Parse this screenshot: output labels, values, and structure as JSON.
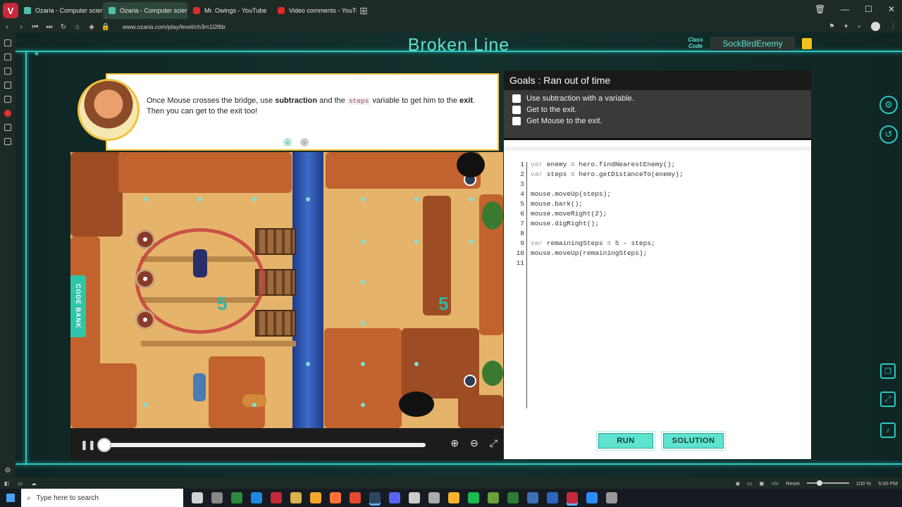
{
  "browser": {
    "tabs": [
      {
        "label": "Ozaria - Computer science",
        "favicon": "ozaria-icon",
        "active": false
      },
      {
        "label": "Ozaria - Computer science",
        "favicon": "ozaria-icon",
        "active": true
      },
      {
        "label": "Mr. Owings - YouTube",
        "favicon": "youtube-icon",
        "active": false
      },
      {
        "label": "Video comments - YouTube",
        "favicon": "youtube-icon",
        "active": false
      }
    ],
    "url": "www.ozaria.com/play/level/ch3m1l2l6b"
  },
  "game": {
    "title": "Broken Line",
    "class_code_label": "Class Code",
    "class_code_value": "SockBirdEnemy",
    "dialogue": {
      "text_parts": [
        "Once Mouse crosses the bridge, use ",
        "subtraction",
        " and the ",
        "steps",
        " variable to get him to the ",
        "exit",
        ". Then you can get to the exit too!"
      ]
    },
    "code_bank_label": "CODE BANK",
    "map_numbers": [
      "5",
      "5"
    ]
  },
  "goals": {
    "title": "Goals : Ran out of time",
    "items": [
      {
        "label": "Use subtraction with a variable.",
        "checked": false
      },
      {
        "label": "Get to the exit.",
        "checked": false
      },
      {
        "label": "Get Mouse to the exit.",
        "checked": false
      }
    ]
  },
  "editor": {
    "lines": [
      {
        "num": "1",
        "code": "var enemy = hero.findNearestEnemy();"
      },
      {
        "num": "2",
        "code": "var steps = hero.getDistanceTo(enemy);"
      },
      {
        "num": "3",
        "code": ""
      },
      {
        "num": "4",
        "code": "mouse.moveUp(steps);"
      },
      {
        "num": "5",
        "code": "mouse.bark();"
      },
      {
        "num": "6",
        "code": "mouse.moveRight(2);"
      },
      {
        "num": "7",
        "code": "mouse.digRight();"
      },
      {
        "num": "8",
        "code": ""
      },
      {
        "num": "9",
        "code": "var remainingSteps = 5 - steps;"
      },
      {
        "num": "10",
        "code": "mouse.moveUp(remainingSteps);"
      },
      {
        "num": "11",
        "code": ""
      }
    ]
  },
  "buttons": {
    "run": "RUN",
    "solution": "SOLUTION"
  },
  "statusbar": {
    "reset": "Reset",
    "zoom": "100 %",
    "time": "5:00 PM"
  },
  "taskbar": {
    "search_placeholder": "Type here to search"
  },
  "colors": {
    "accent": "#5de3cf",
    "frame": "#2ec6c0",
    "brand_red": "#c7283a"
  }
}
